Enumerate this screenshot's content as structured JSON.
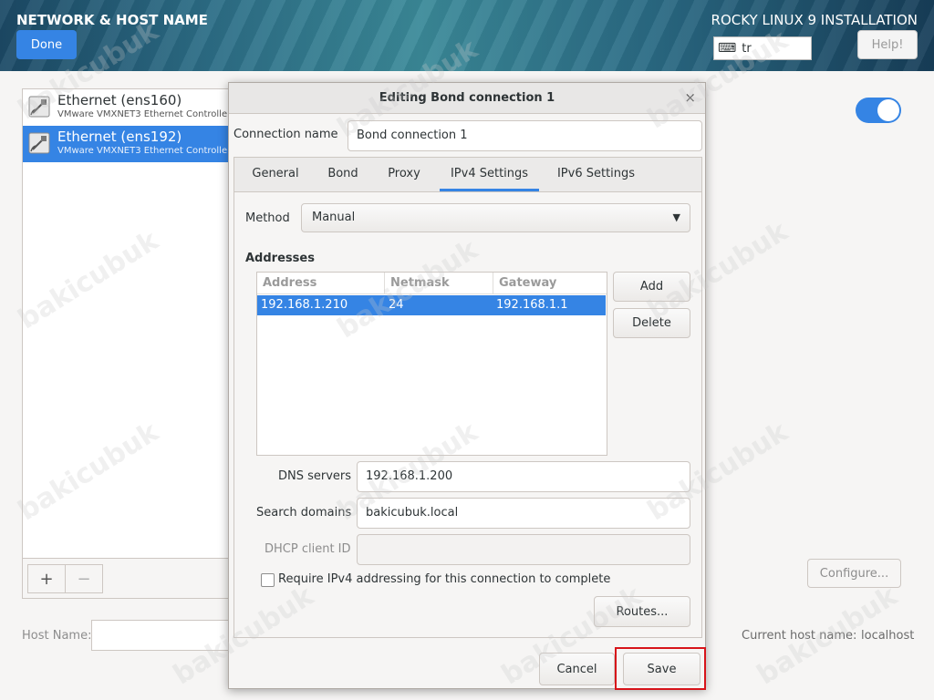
{
  "header": {
    "spoke_title": "NETWORK & HOST NAME",
    "done_label": "Done",
    "product_title": "ROCKY LINUX 9 INSTALLATION",
    "keyboard_layout": "tr",
    "help_label": "Help!"
  },
  "devices": [
    {
      "name": "Ethernet (ens160)",
      "desc": "VMware VMXNET3 Ethernet Controlle",
      "selected": false
    },
    {
      "name": "Ethernet (ens192)",
      "desc": "VMware VMXNET3 Ethernet Controlle",
      "selected": true
    }
  ],
  "list_toolbar": {
    "add_label": "+",
    "remove_label": "−"
  },
  "configure_label": "Configure...",
  "host_name_label": "Host Name:",
  "current_host_label": "Current host name:",
  "current_host_value": "localhost",
  "dialog": {
    "title": "Editing Bond connection 1",
    "close_glyph": "×",
    "connection_name_label": "Connection name",
    "connection_name_value": "Bond connection 1",
    "tabs": [
      "General",
      "Bond",
      "Proxy",
      "IPv4 Settings",
      "IPv6 Settings"
    ],
    "active_tab": "IPv4 Settings",
    "method_label": "Method",
    "method_value": "Manual",
    "addresses_title": "Addresses",
    "table_headers": [
      "Address",
      "Netmask",
      "Gateway"
    ],
    "table_rows": [
      {
        "address": "192.168.1.210",
        "netmask": "24",
        "gateway": "192.168.1.1"
      }
    ],
    "add_label": "Add",
    "delete_label": "Delete",
    "dns_label": "DNS servers",
    "dns_value": "192.168.1.200",
    "search_label": "Search domains",
    "search_value": "bakicubuk.local",
    "dhcp_label": "DHCP client ID",
    "dhcp_value": "",
    "require_label": "Require IPv4 addressing for this connection to complete",
    "require_checked": false,
    "routes_label": "Routes...",
    "cancel_label": "Cancel",
    "save_label": "Save"
  },
  "watermark": "bakicubuk",
  "colors": {
    "accent": "#3584e4",
    "highlight": "#d7141a"
  }
}
